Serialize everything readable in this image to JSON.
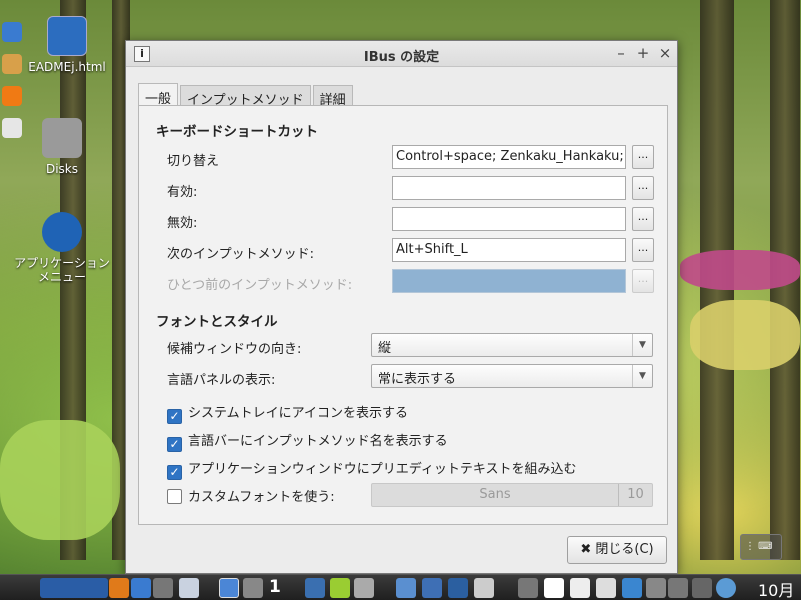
{
  "desktop": {
    "icons": [
      {
        "label": "EADMEj.html"
      },
      {
        "label": "Disks"
      },
      {
        "label": "アプリケーションメニュー"
      }
    ]
  },
  "window": {
    "title": "IBus の設定",
    "tabs": [
      {
        "label": "一般",
        "active": true
      },
      {
        "label": "インプットメソッド",
        "active": false
      },
      {
        "label": "詳細",
        "active": false
      }
    ],
    "keyboard_section": {
      "heading": "キーボードショートカット",
      "rows": [
        {
          "label": "切り替え",
          "value": "Control+space; Zenkaku_Hankaku;",
          "enabled": true
        },
        {
          "label": "有効:",
          "value": "",
          "enabled": true
        },
        {
          "label": "無効:",
          "value": "",
          "enabled": true
        },
        {
          "label": "次のインプットメソッド:",
          "value": "Alt+Shift_L",
          "enabled": true
        },
        {
          "label": "ひとつ前のインプットメソッド:",
          "value": "",
          "enabled": false
        }
      ],
      "button_label": "..."
    },
    "font_section": {
      "heading": "フォントとスタイル",
      "orientation_label": "候補ウィンドウの向き:",
      "orientation_value": "縦",
      "panel_label": "言語パネルの表示:",
      "panel_value": "常に表示する",
      "checks": [
        {
          "label": "システムトレイにアイコンを表示する",
          "checked": true
        },
        {
          "label": "言語バーにインプットメソッド名を表示する",
          "checked": true
        },
        {
          "label": "アプリケーションウィンドウにプリエディットテキストを組み込む",
          "checked": true
        }
      ],
      "custom_font_label": "カスタムフォントを使う:",
      "custom_font_checked": false,
      "font_name": "Sans",
      "font_size": "10"
    },
    "close_label": "閉じる(C)",
    "close_glyph": "✖"
  },
  "taskbar": {
    "workspace_number": "1",
    "clock": "10月"
  },
  "colors": {
    "accent": "#2f74c4",
    "disabled_entry": "#8fb2d2"
  }
}
